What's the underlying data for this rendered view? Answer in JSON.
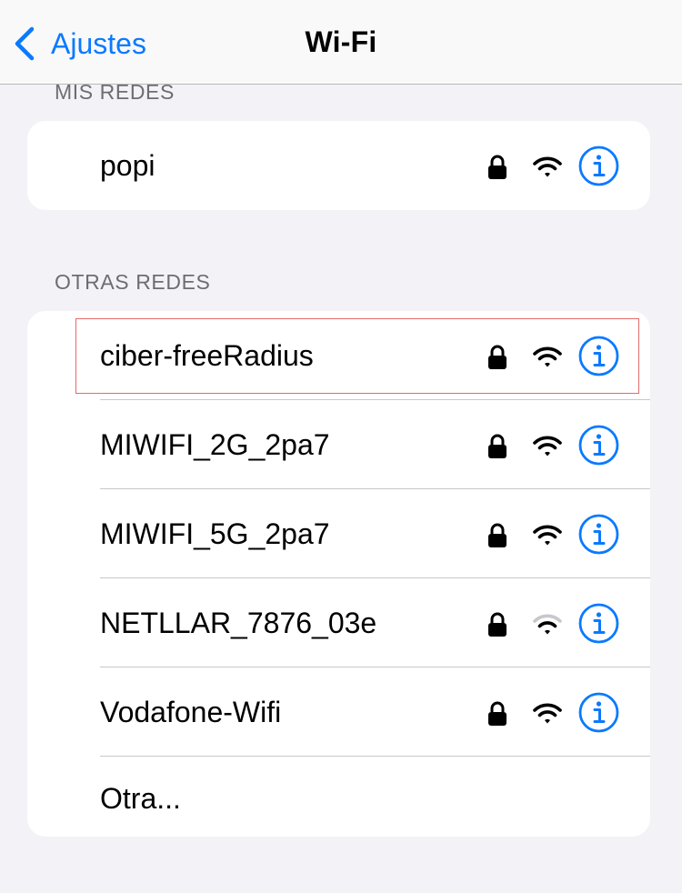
{
  "nav": {
    "back_label": "Ajustes",
    "title": "Wi-Fi"
  },
  "sections": {
    "my_networks_header": "MIS REDES",
    "other_networks_header": "OTRAS REDES"
  },
  "my_networks": [
    {
      "name": "popi",
      "locked": true,
      "signal": "full"
    }
  ],
  "other_networks": [
    {
      "name": "ciber-freeRadius",
      "locked": true,
      "signal": "full"
    },
    {
      "name": "MIWIFI_2G_2pa7",
      "locked": true,
      "signal": "full"
    },
    {
      "name": "MIWIFI_5G_2pa7",
      "locked": true,
      "signal": "full"
    },
    {
      "name": "NETLLAR_7876_03e",
      "locked": true,
      "signal": "weak"
    },
    {
      "name": "Vodafone-Wifi",
      "locked": true,
      "signal": "full"
    }
  ],
  "other_label": "Otra...",
  "colors": {
    "accent": "#0a7aff",
    "background": "#f2f2f7",
    "card": "#ffffff",
    "section_text": "#6d6d72",
    "highlight": "#e36b6b",
    "weak_signal_bar": "#c7c7cc"
  },
  "icons": {
    "back": "chevron-left-icon",
    "lock": "lock-icon",
    "wifi": "wifi-icon",
    "info": "info-icon"
  }
}
